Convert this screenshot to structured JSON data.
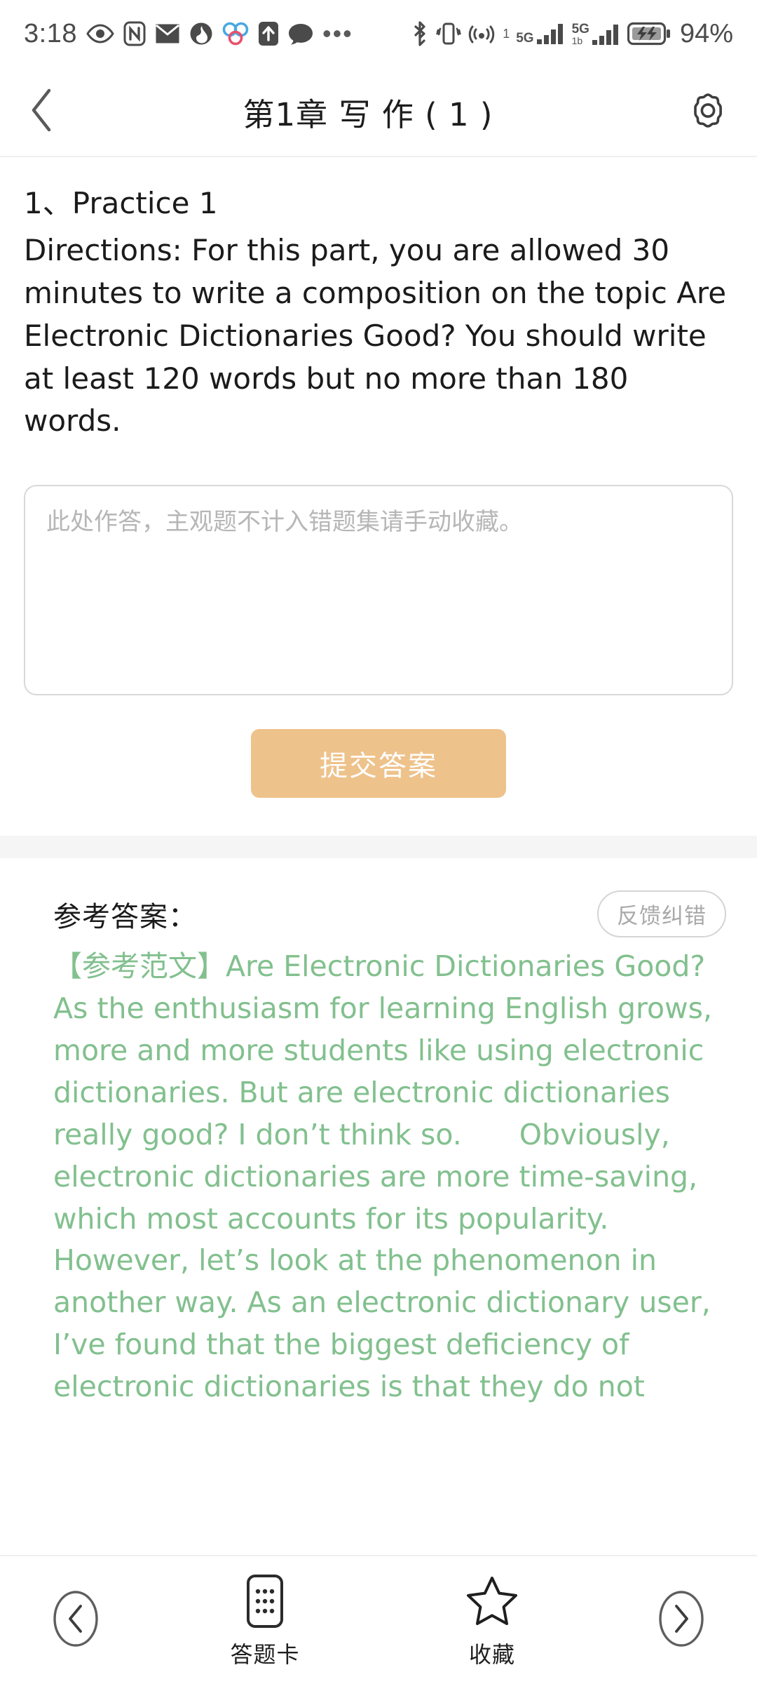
{
  "status_bar": {
    "time": "3:18",
    "battery_percent": "94%",
    "left_icons": [
      "eye-icon",
      "nfc-icon",
      "mail-icon",
      "flame-icon",
      "tricolor-circles-icon",
      "upload-arrow-icon",
      "chat-bubble-icon",
      "more-dots-icon"
    ],
    "right_icons": [
      "bluetooth-icon",
      "vibrate-icon",
      "hotspot-icon",
      "signal-bars-sim1-icon",
      "signal-bars-sim2-icon",
      "battery-charging-icon"
    ],
    "sim1_network": "5G",
    "sim1_index": "1",
    "sim2_network": "5G",
    "sim2_sub": "1b"
  },
  "header": {
    "back_icon": "chevron-left-icon",
    "title": "第1章 写 作 ( 1 )",
    "settings_icon": "gear-icon"
  },
  "question": {
    "number_label": "1、",
    "title": "Practice 1",
    "directions": "Directions: For this part, you are allowed 30 minutes to write a composition on the topic Are Electronic Dictionaries Good? You should write at least 120 words but no more than 180 words."
  },
  "answer_input": {
    "placeholder": "此处作答，主观题不计入错题集请手动收藏。",
    "value": ""
  },
  "submit": {
    "label": "提交答案",
    "color": "#eec28b"
  },
  "reference": {
    "heading": "参考答案：",
    "feedback_label": "反馈纠错",
    "text_color": "#82c08e",
    "text": "【参考范文】Are Electronic Dictionaries Good?　　As the enthusiasm for learning English grows, more and more students like using electronic dictionaries. But are electronic dictionaries really good? I don’t think so.　　Obviously, electronic dictionaries are more time-saving, which most accounts for its popularity. However, let’s look at the phenomenon in another way. As an electronic dictionary user, I’ve found that the biggest deficiency of electronic dictionaries is that they do not"
  },
  "bottom_bar": {
    "prev_icon": "chevron-left-circle-icon",
    "next_icon": "chevron-right-circle-icon",
    "items": [
      {
        "icon": "answer-card-icon",
        "label": "答题卡"
      },
      {
        "icon": "star-outline-icon",
        "label": "收藏"
      }
    ]
  }
}
